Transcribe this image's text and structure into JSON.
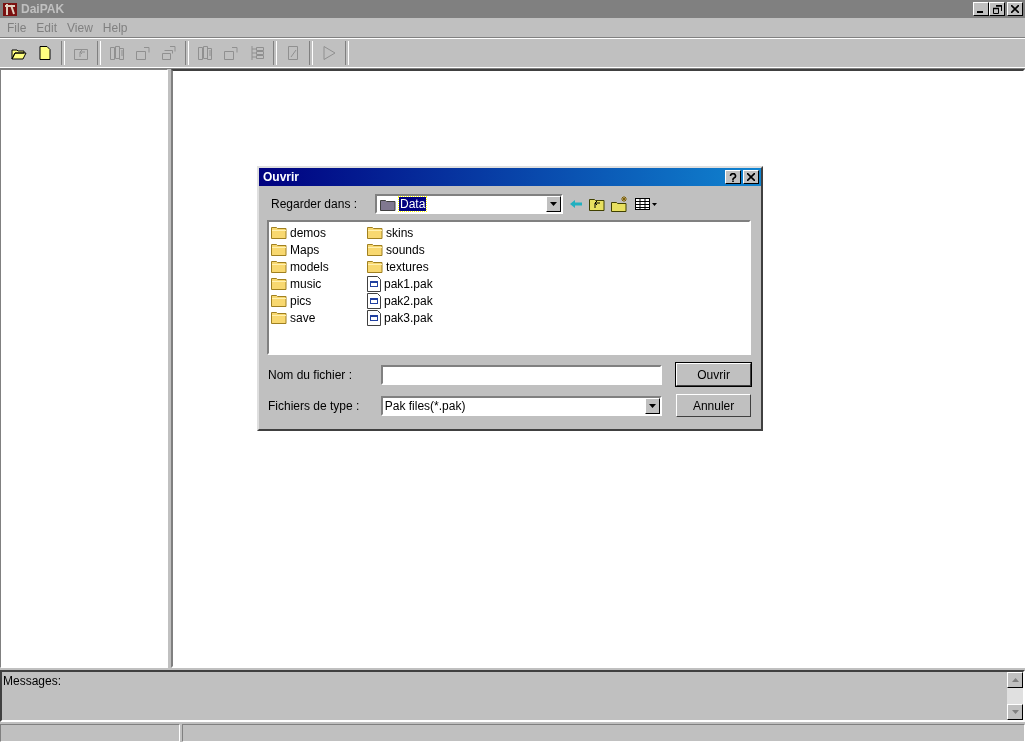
{
  "window": {
    "title": "DaiPAK",
    "active": false
  },
  "menu": [
    {
      "label": "File"
    },
    {
      "label": "Edit"
    },
    {
      "label": "View"
    },
    {
      "label": "Help"
    }
  ],
  "toolbar": [
    [
      {
        "kind": "open",
        "disabled": false
      },
      {
        "kind": "new",
        "disabled": false
      }
    ],
    [
      {
        "kind": "up",
        "disabled": true
      }
    ],
    [
      {
        "kind": "pages",
        "disabled": true
      },
      {
        "kind": "addfile",
        "disabled": true
      },
      {
        "kind": "addfiles",
        "disabled": true
      }
    ],
    [
      {
        "kind": "pages",
        "disabled": true
      },
      {
        "kind": "addfile",
        "disabled": true
      },
      {
        "kind": "tree",
        "disabled": true
      }
    ],
    [
      {
        "kind": "edit",
        "disabled": true
      }
    ],
    [
      {
        "kind": "play",
        "disabled": true
      }
    ]
  ],
  "messages": {
    "label": "Messages:"
  },
  "dialog": {
    "title": "Ouvrir",
    "look_in_label": "Regarder dans :",
    "look_in_value": "Data",
    "files": [
      {
        "name": "demos",
        "kind": "folder"
      },
      {
        "name": "Maps",
        "kind": "folder"
      },
      {
        "name": "models",
        "kind": "folder"
      },
      {
        "name": "music",
        "kind": "folder"
      },
      {
        "name": "pics",
        "kind": "folder"
      },
      {
        "name": "save",
        "kind": "folder"
      },
      {
        "name": "skins",
        "kind": "folder"
      },
      {
        "name": "sounds",
        "kind": "folder"
      },
      {
        "name": "textures",
        "kind": "folder"
      },
      {
        "name": "pak1.pak",
        "kind": "file"
      },
      {
        "name": "pak2.pak",
        "kind": "file"
      },
      {
        "name": "pak3.pak",
        "kind": "file"
      }
    ],
    "filename_label": "Nom du fichier :",
    "filetype_label": "Fichiers de type :",
    "filetype_value": "Pak files(*.pak)",
    "buttons": [
      "Ouvrir",
      "Annuler"
    ]
  }
}
